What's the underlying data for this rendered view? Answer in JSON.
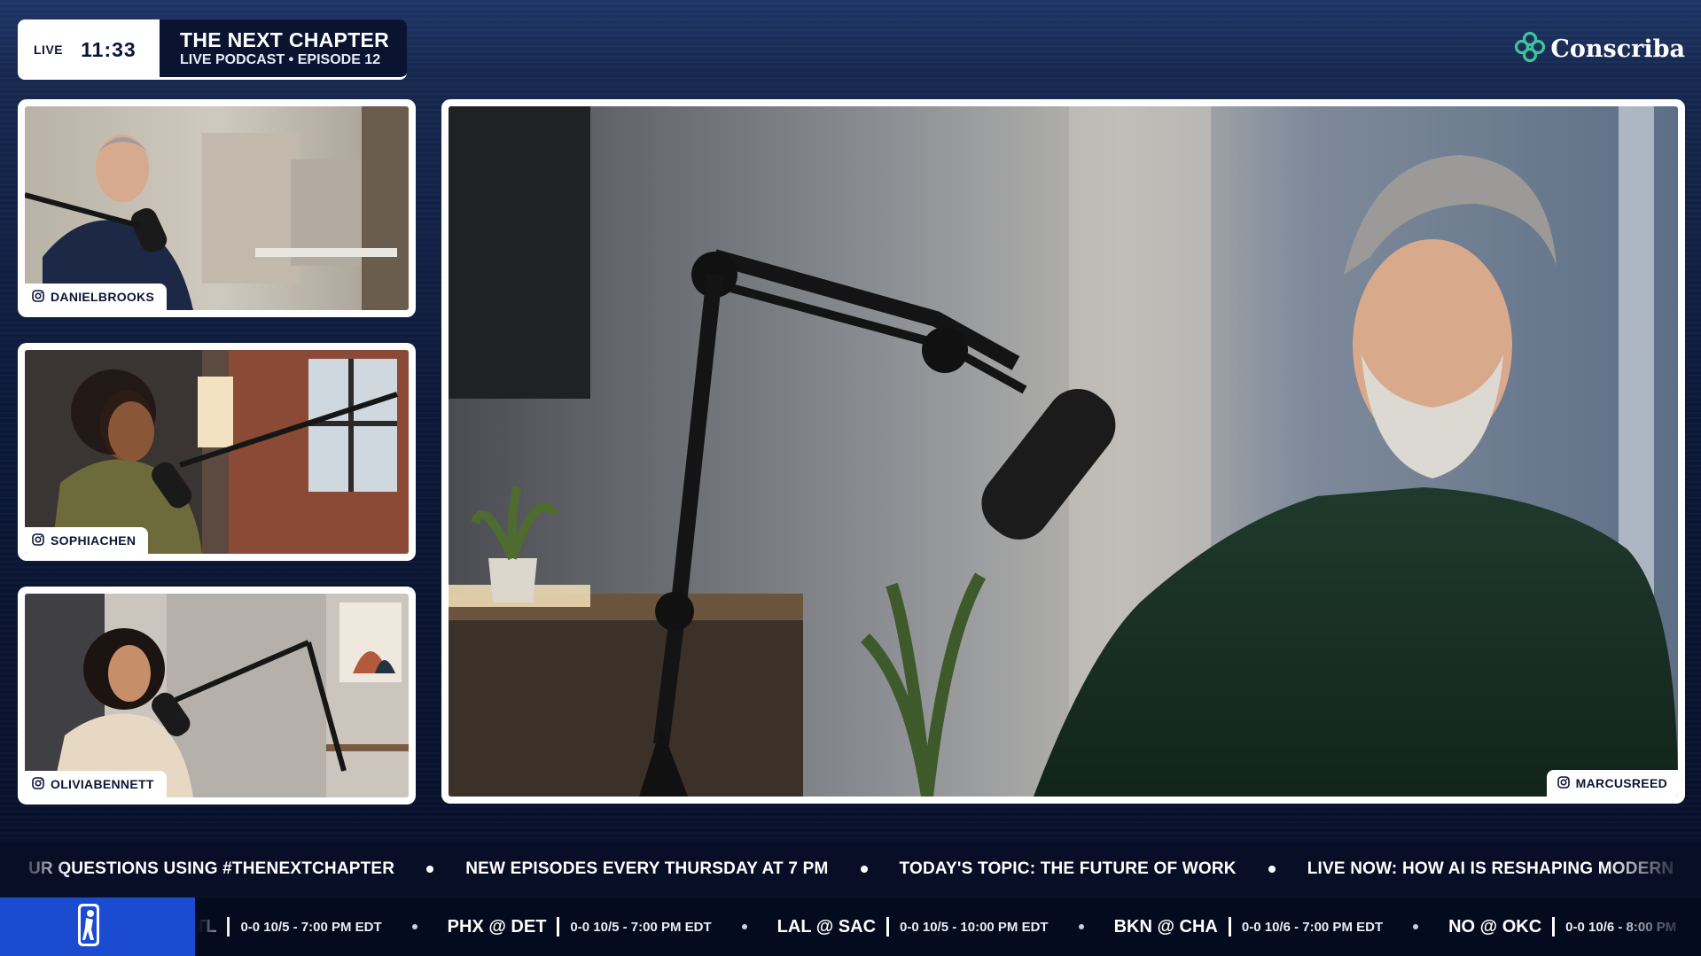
{
  "header": {
    "live_label": "LIVE",
    "clock": "11:33",
    "show_title": "THE NEXT CHAPTER",
    "show_subtitle": "LIVE PODCAST • EPISODE 12"
  },
  "brand": {
    "name": "Conscriba",
    "icon": "clover-knot-icon",
    "color": "#3fc39a"
  },
  "participants": [
    {
      "handle": "DANIELBROOKS",
      "icon": "instagram-icon",
      "slot": "thumbnail-1"
    },
    {
      "handle": "SOPHIACHEN",
      "icon": "instagram-icon",
      "slot": "thumbnail-2"
    },
    {
      "handle": "OLIVIABENNETT",
      "icon": "instagram-icon",
      "slot": "thumbnail-3"
    },
    {
      "handle": "MARCUSREED",
      "icon": "instagram-icon",
      "slot": "main-speaker"
    }
  ],
  "ticker": {
    "items": [
      "UR QUESTIONS USING #THENEXTCHAPTER",
      "NEW EPISODES EVERY THURSDAY AT 7 PM",
      "TODAY'S TOPIC: THE FUTURE OF WORK",
      "LIVE NOW: HOW AI IS RESHAPING MODERN"
    ]
  },
  "scoreboard": {
    "league_icon": "basketball-league-logo-icon",
    "accent": "#1b4bd0",
    "games": [
      {
        "matchup": "TL",
        "time": "0-0 10/5 - 7:00 PM EDT"
      },
      {
        "matchup": "PHX @ DET",
        "time": "0-0 10/5 - 7:00 PM EDT"
      },
      {
        "matchup": "LAL @ SAC",
        "time": "0-0 10/5 - 10:00 PM EDT"
      },
      {
        "matchup": "BKN @ CHA",
        "time": "0-0 10/6 - 7:00 PM EDT"
      },
      {
        "matchup": "NO @ OKC",
        "time": "0-0 10/6 - 8:00 PM"
      }
    ]
  }
}
